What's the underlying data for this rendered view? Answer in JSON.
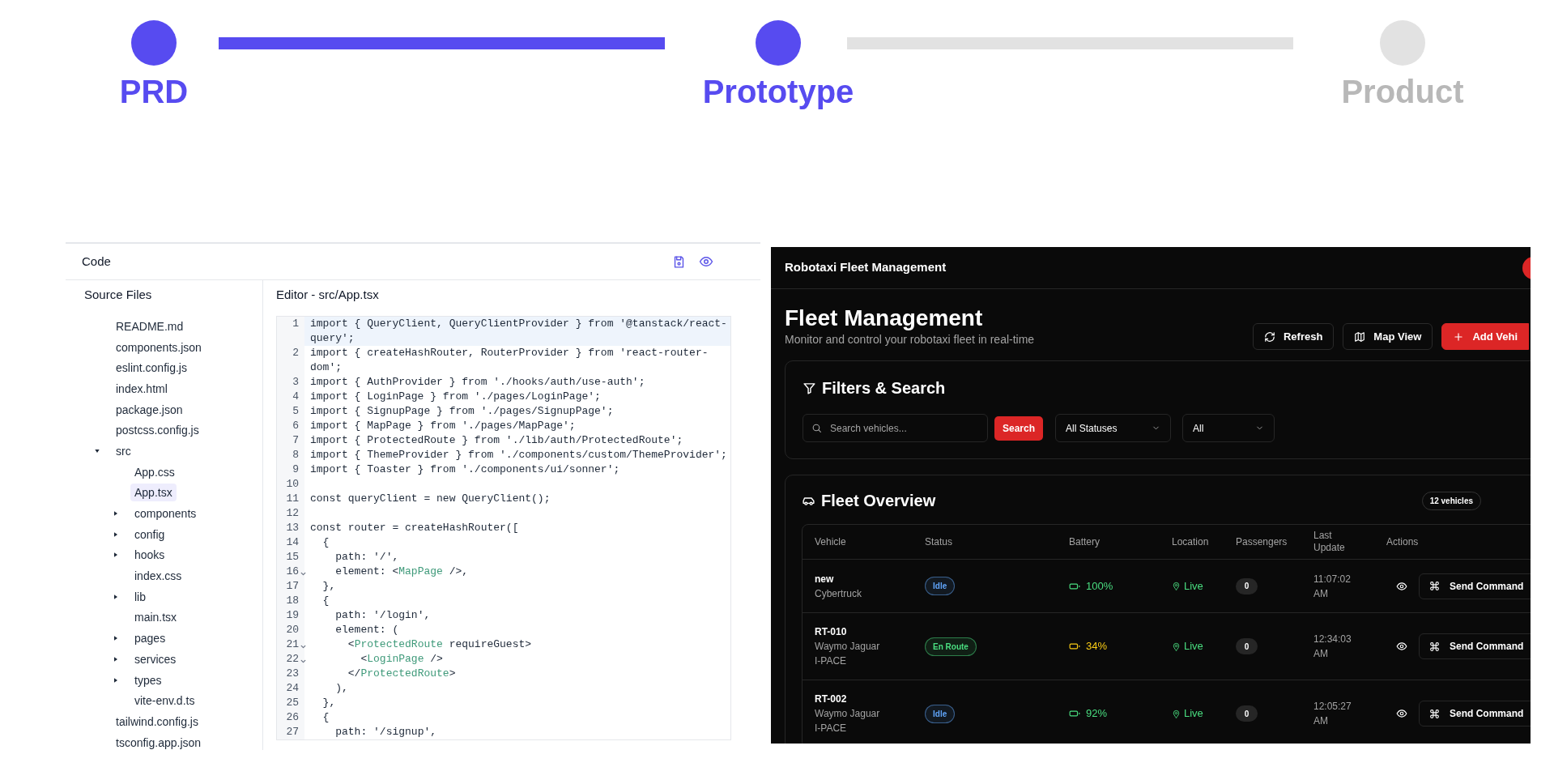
{
  "steps": [
    {
      "label": "PRD",
      "reached": true
    },
    {
      "label": "Prototype",
      "reached": true
    },
    {
      "label": "Product",
      "reached": false
    }
  ],
  "code_panel": {
    "title": "Code",
    "sidebar_title": "Source Files",
    "editor_title": "Editor - src/App.tsx",
    "tree": [
      {
        "name": "README.md",
        "kind": "file",
        "selected": false
      },
      {
        "name": "components.json",
        "kind": "file",
        "selected": false
      },
      {
        "name": "eslint.config.js",
        "kind": "file",
        "selected": false
      },
      {
        "name": "index.html",
        "kind": "file",
        "selected": false
      },
      {
        "name": "package.json",
        "kind": "file",
        "selected": false
      },
      {
        "name": "postcss.config.js",
        "kind": "file",
        "selected": false
      },
      {
        "name": "src",
        "kind": "folder",
        "expanded": true,
        "selected": false,
        "children": [
          {
            "name": "App.css",
            "kind": "file",
            "selected": false
          },
          {
            "name": "App.tsx",
            "kind": "file",
            "selected": true
          },
          {
            "name": "components",
            "kind": "folder",
            "expanded": false,
            "selected": false
          },
          {
            "name": "config",
            "kind": "folder",
            "expanded": false,
            "selected": false
          },
          {
            "name": "hooks",
            "kind": "folder",
            "expanded": false,
            "selected": false
          },
          {
            "name": "index.css",
            "kind": "file",
            "selected": false
          },
          {
            "name": "lib",
            "kind": "folder",
            "expanded": false,
            "selected": false
          },
          {
            "name": "main.tsx",
            "kind": "file",
            "selected": false
          },
          {
            "name": "pages",
            "kind": "folder",
            "expanded": false,
            "selected": false
          },
          {
            "name": "services",
            "kind": "folder",
            "expanded": false,
            "selected": false
          },
          {
            "name": "types",
            "kind": "folder",
            "expanded": false,
            "selected": false
          },
          {
            "name": "vite-env.d.ts",
            "kind": "file",
            "selected": false
          }
        ]
      },
      {
        "name": "tailwind.config.js",
        "kind": "file",
        "selected": false
      },
      {
        "name": "tsconfig.app.json",
        "kind": "file",
        "selected": false
      }
    ],
    "lines": [
      {
        "number": "1",
        "code": "import { QueryClient, QueryClientProvider } from '@tanstack/react-query';",
        "active": true,
        "foldable": false
      },
      {
        "number": "2",
        "code": "import { createHashRouter, RouterProvider } from 'react-router-dom';",
        "active": false,
        "foldable": false
      },
      {
        "number": "3",
        "code": "import { AuthProvider } from './hooks/auth/use-auth';",
        "active": false,
        "foldable": false
      },
      {
        "number": "4",
        "code": "import { LoginPage } from './pages/LoginPage';",
        "active": false,
        "foldable": false
      },
      {
        "number": "5",
        "code": "import { SignupPage } from './pages/SignupPage';",
        "active": false,
        "foldable": false
      },
      {
        "number": "6",
        "code": "import { MapPage } from './pages/MapPage';",
        "active": false,
        "foldable": false
      },
      {
        "number": "7",
        "code": "import { ProtectedRoute } from './lib/auth/ProtectedRoute';",
        "active": false,
        "foldable": false
      },
      {
        "number": "8",
        "code": "import { ThemeProvider } from './components/custom/ThemeProvider';",
        "active": false,
        "foldable": false
      },
      {
        "number": "9",
        "code": "import { Toaster } from './components/ui/sonner';",
        "active": false,
        "foldable": false
      },
      {
        "number": "10",
        "active": false,
        "foldable": false
      },
      {
        "number": "11",
        "code": "const queryClient = new QueryClient();",
        "active": false,
        "foldable": false
      },
      {
        "number": "12",
        "active": false,
        "foldable": false
      },
      {
        "number": "13",
        "code": "const router = createHashRouter([",
        "active": false,
        "foldable": false
      },
      {
        "number": "14",
        "code": "  {",
        "active": false,
        "foldable": false
      },
      {
        "number": "15",
        "code": "    path: '/',",
        "active": false,
        "foldable": false
      },
      {
        "number": "16",
        "tokens": [
          {
            "text": "    element: <",
            "kind": "plain"
          },
          {
            "text": "MapPage",
            "kind": "tag"
          },
          {
            "text": " />,",
            "kind": "plain"
          }
        ],
        "active": false,
        "foldable": true
      },
      {
        "number": "17",
        "code": "  },",
        "active": false,
        "foldable": false
      },
      {
        "number": "18",
        "code": "  {",
        "active": false,
        "foldable": false
      },
      {
        "number": "19",
        "code": "    path: '/login',",
        "active": false,
        "foldable": false
      },
      {
        "number": "20",
        "code": "    element: (",
        "active": false,
        "foldable": false
      },
      {
        "number": "21",
        "tokens": [
          {
            "text": "      <",
            "kind": "plain"
          },
          {
            "text": "ProtectedRoute",
            "kind": "tag"
          },
          {
            "text": " requireGuest>",
            "kind": "plain"
          }
        ],
        "active": false,
        "foldable": true
      },
      {
        "number": "22",
        "tokens": [
          {
            "text": "        <",
            "kind": "plain"
          },
          {
            "text": "LoginPage",
            "kind": "tag"
          },
          {
            "text": " />",
            "kind": "plain"
          }
        ],
        "active": false,
        "foldable": true
      },
      {
        "number": "23",
        "tokens": [
          {
            "text": "      </",
            "kind": "plain"
          },
          {
            "text": "ProtectedRoute",
            "kind": "tag"
          },
          {
            "text": ">",
            "kind": "plain"
          }
        ],
        "active": false,
        "foldable": false
      },
      {
        "number": "24",
        "code": "    ),",
        "active": false,
        "foldable": false
      },
      {
        "number": "25",
        "code": "  },",
        "active": false,
        "foldable": false
      },
      {
        "number": "26",
        "code": "  {",
        "active": false,
        "foldable": false
      },
      {
        "number": "27",
        "code": "    path: '/signup',",
        "active": false,
        "foldable": false
      }
    ]
  },
  "app": {
    "title": "Robotaxi Fleet Management",
    "heading": "Fleet Management",
    "subtitle": "Monitor and control your robotaxi fleet in real-time",
    "actions": [
      {
        "label": "Refresh",
        "kind": "refresh"
      },
      {
        "label": "Map View",
        "kind": "map"
      },
      {
        "label": "Add Vehi",
        "kind": "add"
      }
    ],
    "filters": {
      "title": "Filters & Search",
      "search": {
        "placeholder": "Search vehicles..."
      },
      "search_button": "Search",
      "dropdowns": [
        "All Statuses",
        "All"
      ]
    },
    "fleet": {
      "title": "Fleet Overview",
      "count": "12 vehicles",
      "columns": [
        "Vehicle",
        "Status",
        "Battery",
        "Location",
        "Passengers",
        "Last Update",
        "Actions"
      ],
      "rows": [
        {
          "id": "new",
          "model": "Cybertruck",
          "status": {
            "label": "Idle",
            "color": "#60a5fa"
          },
          "battery": {
            "reading": "100%",
            "color": "#4ade80"
          },
          "location": "Live",
          "passengers": "0",
          "last_update": "11:07:02 AM",
          "command": "Send Command"
        },
        {
          "id": "RT-010",
          "model": "Waymo Jaguar I-PACE",
          "status": {
            "label": "En Route",
            "color": "#4ade80"
          },
          "battery": {
            "reading": "34%",
            "color": "#facc15"
          },
          "location": "Live",
          "passengers": "0",
          "last_update": "12:34:03 AM",
          "command": "Send Command"
        },
        {
          "id": "RT-002",
          "model": "Waymo Jaguar I-PACE",
          "status": {
            "label": "Idle",
            "color": "#60a5fa"
          },
          "battery": {
            "reading": "92%",
            "color": "#4ade80"
          },
          "location": "Live",
          "passengers": "0",
          "last_update": "12:05:27 AM",
          "command": "Send Command"
        }
      ]
    }
  }
}
